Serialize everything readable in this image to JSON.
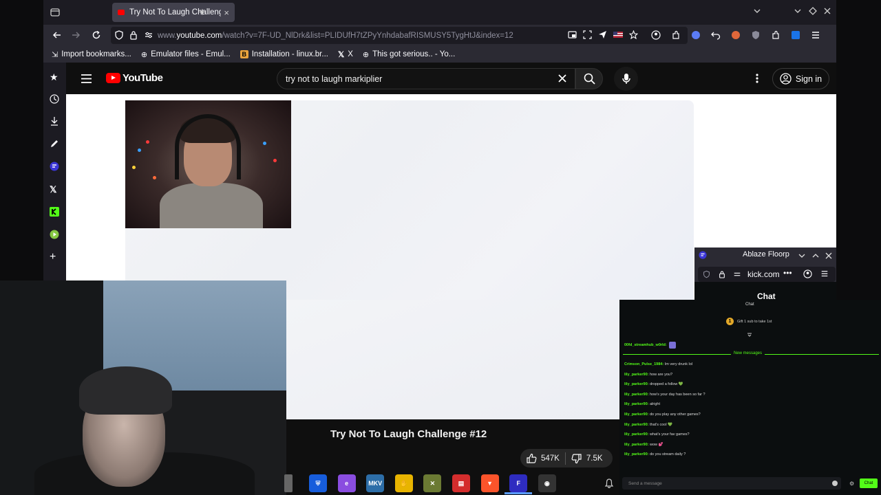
{
  "browser": {
    "tab_title": "Try Not To Laugh Challenge",
    "url_prefix": "www.",
    "url_domain": "youtube.com",
    "url_rest": "/watch?v=7F-UD_NlDrk&list=PLIDUfH7tZPyYnhdabafRISMUSY5TygHtJ&index=12",
    "bookmarks": [
      {
        "label": "Import bookmarks..."
      },
      {
        "label": "Emulator files - Emul..."
      },
      {
        "label": "Installation - linux.br..."
      },
      {
        "label": "X"
      },
      {
        "label": "This got serious.. - Yo..."
      }
    ]
  },
  "youtube": {
    "logo_text": "YouTube",
    "search_query": "try not to laugh markiplier",
    "sign_in_label": "Sign in",
    "video_title": "Try Not To Laugh Challenge #12",
    "likes": "547K",
    "dislikes": "7.5K"
  },
  "floorp": {
    "title": "Ablaze Floorp",
    "url": "kick.com"
  },
  "chat": {
    "title": "Chat",
    "subtitle": "Chat",
    "gift_text": "Gift 1 sub to take 1st",
    "pinned_user": "00fd_streamhub_w0rld:",
    "new_messages_label": "New messages",
    "messages": [
      {
        "user": "Crimson_Pulse_1984:",
        "text": "Im very drunk lol"
      },
      {
        "user": "lily_parker90:",
        "text": "how are you?"
      },
      {
        "user": "lily_parker90:",
        "text": "dropped a follow 💚"
      },
      {
        "user": "lily_parker90:",
        "text": "how's your day has been so far ?"
      },
      {
        "user": "lily_parker90:",
        "text": "alright"
      },
      {
        "user": "lily_parker90:",
        "text": "do you play any other games?"
      },
      {
        "user": "lily_parker90:",
        "text": "that's cool 💚"
      },
      {
        "user": "lily_parker90:",
        "text": "what's your fav games?"
      },
      {
        "user": "lily_parker90:",
        "text": "wow 💕"
      },
      {
        "user": "lily_parker90:",
        "text": "do you stream daily ?"
      }
    ],
    "input_placeholder": "Send a message",
    "send_label": "Chat"
  },
  "taskbar": [
    {
      "name": "bitwarden-icon",
      "color": "#175ddc",
      "glyph": "⛨"
    },
    {
      "name": "edge-icon",
      "color": "#8a4de0",
      "glyph": "e"
    },
    {
      "name": "mkv-icon",
      "color": "#2d6ea8",
      "glyph": "MKV"
    },
    {
      "name": "wave-icon",
      "color": "#e8b400",
      "glyph": "✋"
    },
    {
      "name": "xbox-icon",
      "color": "#6b7a33",
      "glyph": "✕"
    },
    {
      "name": "files-icon",
      "color": "#d42d2d",
      "glyph": "▤"
    },
    {
      "name": "brave-icon",
      "color": "#fb542b",
      "glyph": "▼"
    },
    {
      "name": "floorp-icon",
      "color": "#2e2cc0",
      "glyph": "F"
    },
    {
      "name": "obs-icon",
      "color": "#333333",
      "glyph": "◉"
    }
  ]
}
